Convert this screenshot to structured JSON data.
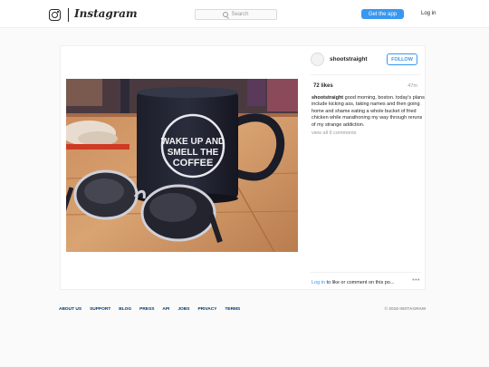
{
  "header": {
    "wordmark": "Instagram",
    "search_placeholder": "Search",
    "get_app_label": "Get the app",
    "login_label": "Log in"
  },
  "post": {
    "username": "shootstraight",
    "follow_label": "FOLLOW",
    "likes": "72 likes",
    "time": "47m",
    "caption_user": "shootstraight",
    "caption_text": " good morning, boston. today's plans include kicking ass, taking names and then going home and shame eating a whole bucket of fried chicken while marathoning my way through reruns of my strange addiction.",
    "view_all": "view all 9 comments",
    "login_link": "Log in",
    "comment_prompt": " to like or comment on this po...",
    "more_label": "•••",
    "mug_text": [
      "WAKE UP AND",
      "SMELL THE",
      "COFFEE"
    ]
  },
  "footer": {
    "links": [
      "ABOUT US",
      "SUPPORT",
      "BLOG",
      "PRESS",
      "API",
      "JOBS",
      "PRIVACY",
      "TERMS"
    ],
    "copyright": "© 2016 INSTAGRAM"
  },
  "colors": {
    "accent": "#3897f0",
    "footer_link": "#003569",
    "muted": "#999999"
  }
}
